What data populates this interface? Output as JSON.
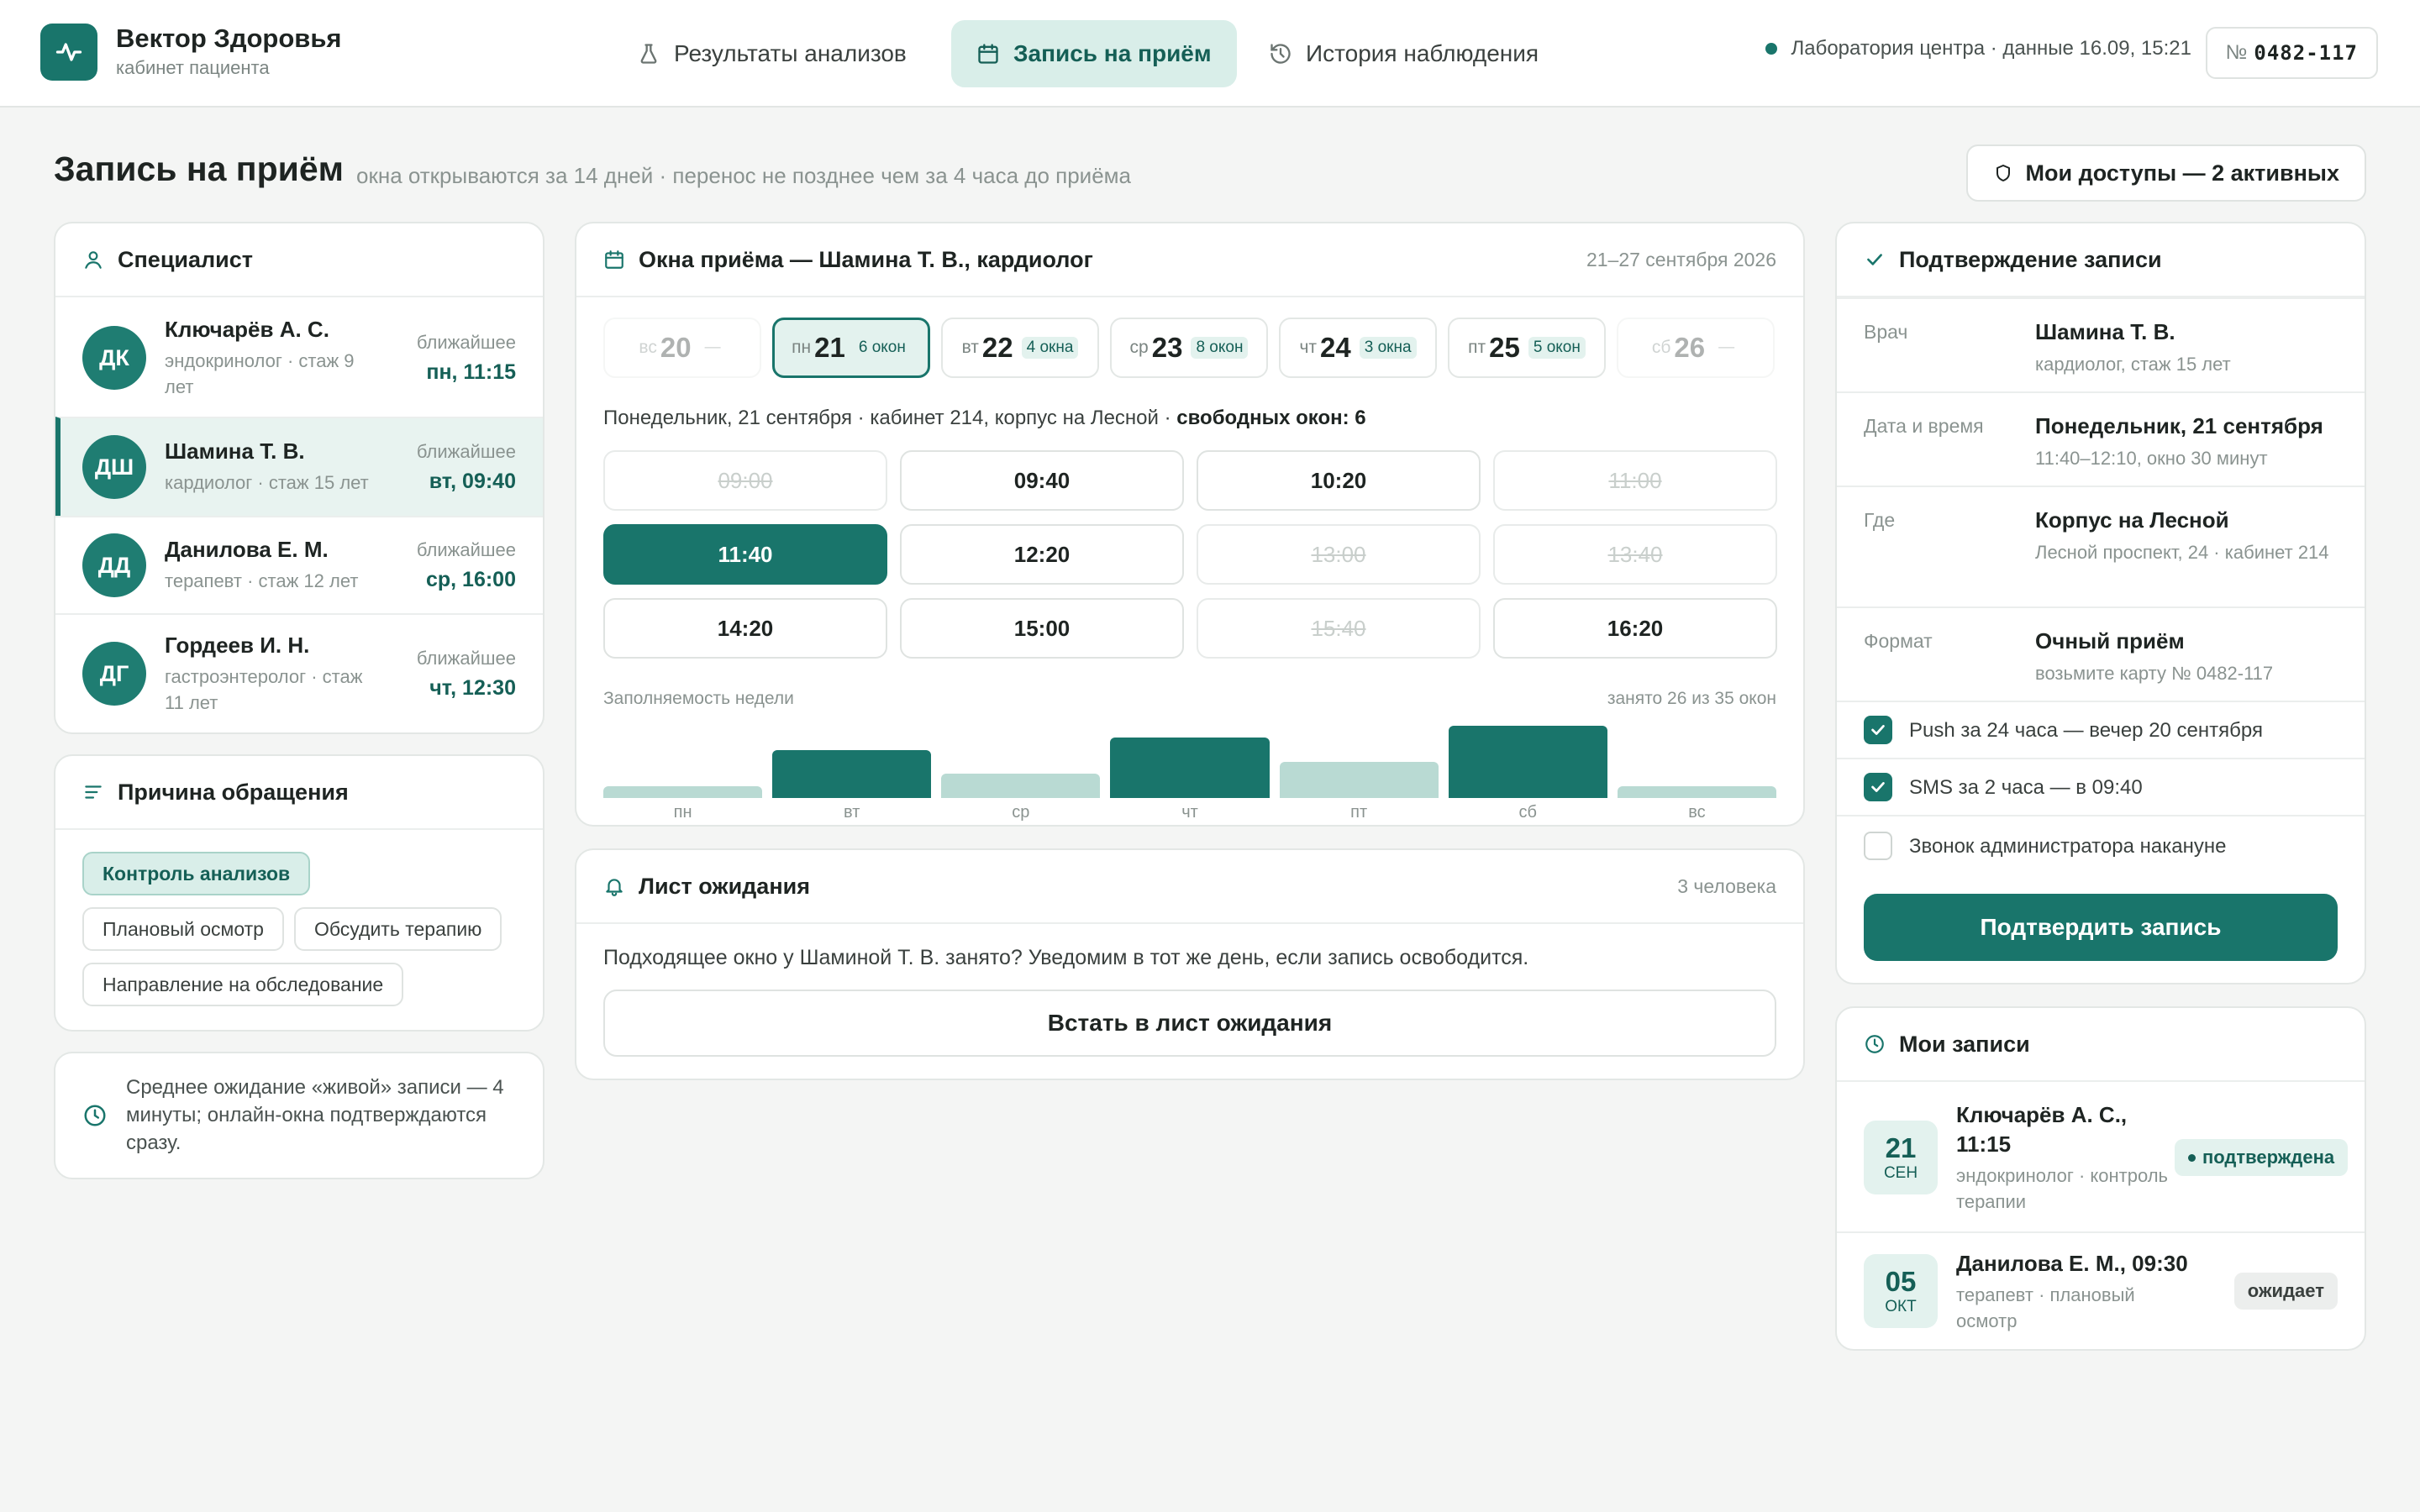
{
  "brand": {
    "name": "Вектор Здоровья",
    "sub": "кабинет пациента"
  },
  "nav": {
    "tabs": [
      {
        "label": "Результаты анализов",
        "icon": "flask-icon"
      },
      {
        "label": "Запись на приём",
        "icon": "calendar-icon"
      },
      {
        "label": "История наблюдения",
        "icon": "history-icon"
      }
    ]
  },
  "status": {
    "lab": "Лаборатория центра · данные 16.09, 15:21",
    "patient_prefix": "№",
    "patient_id": "0482-117"
  },
  "page": {
    "title": "Запись на приём",
    "subtitle": "окна открываются за 14 дней · перенос не позднее чем за 4 часа до приёма",
    "access_button": "Мои доступы — 2 активных"
  },
  "specialists": {
    "title": "Специалист",
    "items": [
      {
        "initials": "ДК",
        "name": "Ключарёв А. С.",
        "spec": "эндокринолог · стаж 9 лет",
        "next_label": "ближайшее",
        "next": "пн, 11:15"
      },
      {
        "initials": "ДШ",
        "name": "Шамина Т. В.",
        "spec": "кардиолог · стаж 15 лет",
        "next_label": "ближайшее",
        "next": "вт, 09:40"
      },
      {
        "initials": "ДД",
        "name": "Данилова Е. М.",
        "spec": "терапевт · стаж 12 лет",
        "next_label": "ближайшее",
        "next": "ср, 16:00"
      },
      {
        "initials": "ДГ",
        "name": "Гордеев И. Н.",
        "spec": "гастроэнтеролог · стаж 11 лет",
        "next_label": "ближайшее",
        "next": "чт, 12:30"
      }
    ]
  },
  "reason": {
    "title": "Причина обращения",
    "chips": [
      "Контроль анализов",
      "Плановый осмотр",
      "Обсудить терапию",
      "Направление на обследование"
    ]
  },
  "wait_note": "Среднее ожидание «живой» записи — 4 минуты; онлайн-окна подтверждаются сразу.",
  "slots": {
    "title": "Окна приёма — Шамина Т. В., кардиолог",
    "range": "21–27 сентября 2026",
    "days": [
      {
        "dow": "вс",
        "num": "20",
        "count": "—"
      },
      {
        "dow": "пн",
        "num": "21",
        "count": "6 окон"
      },
      {
        "dow": "вт",
        "num": "22",
        "count": "4 окна"
      },
      {
        "dow": "ср",
        "num": "23",
        "count": "8 окон"
      },
      {
        "dow": "чт",
        "num": "24",
        "count": "3 окна"
      },
      {
        "dow": "пт",
        "num": "25",
        "count": "5 окон"
      },
      {
        "dow": "сб",
        "num": "26",
        "count": "—"
      }
    ],
    "info": "Понедельник, 21 сентября · кабинет 214, корпус на Лесной · ",
    "free": "свободных окон: 6",
    "times": [
      "09:00",
      "09:40",
      "10:20",
      "11:00",
      "11:40",
      "12:20",
      "13:00",
      "13:40",
      "14:20",
      "15:00",
      "15:40",
      "16:20"
    ],
    "time_state": [
      "busy",
      "free",
      "free",
      "busy",
      "selected",
      "free",
      "busy",
      "busy",
      "free",
      "free",
      "busy",
      "free"
    ],
    "load_label": "Заполняемость недели",
    "load_total": "занято 26 из 35 окон"
  },
  "chart_data": {
    "type": "bar",
    "categories": [
      "пн",
      "вт",
      "ср",
      "чт",
      "пт",
      "сб",
      "вс"
    ],
    "values": [
      1,
      4,
      2,
      5,
      3,
      6,
      1
    ],
    "ylim": [
      0,
      6
    ]
  },
  "waitlist": {
    "title": "Лист ожидания",
    "count": "3 человека",
    "text": "Подходящее окно у Шаминой Т. В. занято? Уведомим в тот же день, если запись освободится.",
    "button": "Встать в лист ожидания"
  },
  "confirm": {
    "title": "Подтверждение записи",
    "rows": [
      {
        "key": "Врач",
        "value": "Шамина Т. В.",
        "sub": "кардиолог, стаж 15 лет"
      },
      {
        "key": "Дата и время",
        "value": "Понедельник, 21 сентября",
        "sub": "11:40–12:10, окно 30 минут"
      },
      {
        "key": "Где",
        "value": "Корпус на Лесной",
        "sub": "Лесной проспект, 24 · кабинет 214"
      },
      {
        "key": "Формат",
        "value": "Очный приём",
        "sub": "возьмите карту № 0482-117"
      }
    ],
    "options": [
      {
        "label": "Push за 24 часа — вечер 20 сентября",
        "checked": true
      },
      {
        "label": "SMS за 2 часа — в 09:40",
        "checked": true
      },
      {
        "label": "Звонок администратора накануне",
        "checked": false
      }
    ],
    "button": "Подтвердить запись"
  },
  "my_appointments": {
    "title": "Мои записи",
    "items": [
      {
        "day": "21",
        "month": "СЕН",
        "name": "Ключарёв А. С., 11:15",
        "sub": "эндокринолог · контроль терапии",
        "status": "подтверждена"
      },
      {
        "day": "05",
        "month": "ОКТ",
        "name": "Данилова Е. М., 09:30",
        "sub": "терапевт · плановый осмотр",
        "status": "ожидает"
      }
    ]
  },
  "colors": {
    "accent": "#19756b",
    "accent_light": "#d9eee9",
    "bar_low": "#b9dad3"
  }
}
